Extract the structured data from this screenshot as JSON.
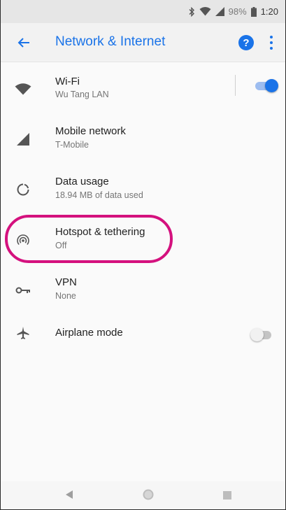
{
  "status_bar": {
    "icons": [
      "bluetooth-icon",
      "wifi-signal-icon",
      "cell-signal-icon",
      "battery-icon"
    ],
    "battery_percent": "98%",
    "time": "1:20"
  },
  "app_bar": {
    "title": "Network & Internet",
    "back_icon": "arrow-back-icon",
    "help_icon": "help-icon",
    "help_glyph": "?",
    "more_icon": "more-vert-icon"
  },
  "settings": [
    {
      "id": "wifi",
      "icon": "wifi-icon",
      "title": "Wi-Fi",
      "subtitle": "Wu Tang LAN",
      "toggle": true
    },
    {
      "id": "mobile-network",
      "icon": "cell-signal-icon",
      "title": "Mobile network",
      "subtitle": "T-Mobile"
    },
    {
      "id": "data-usage",
      "icon": "data-usage-icon",
      "title": "Data usage",
      "subtitle": "18.94 MB of data used"
    },
    {
      "id": "hotspot",
      "icon": "hotspot-icon",
      "title": "Hotspot & tethering",
      "subtitle": "Off",
      "highlighted": true
    },
    {
      "id": "vpn",
      "icon": "vpn-key-icon",
      "title": "VPN",
      "subtitle": "None"
    },
    {
      "id": "airplane-mode",
      "icon": "airplane-icon",
      "title": "Airplane mode",
      "toggle": false
    }
  ],
  "colors": {
    "accent": "#1a73e8",
    "highlight_ring": "#d4117e",
    "text_primary": "#212121",
    "text_secondary": "#757575"
  },
  "nav_bar": {
    "icons": [
      "nav-back-icon",
      "nav-home-icon",
      "nav-recents-icon"
    ]
  }
}
